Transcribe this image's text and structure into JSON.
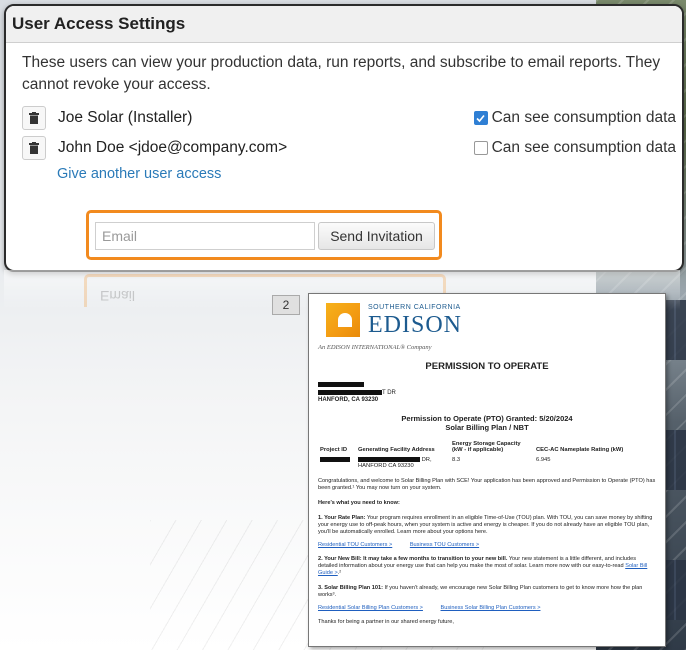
{
  "dialog": {
    "title": "User Access Settings",
    "description": "These users can view your production data, run reports, and subscribe to email reports. They cannot revoke your access.",
    "users": [
      {
        "name": "Joe Solar (Installer)",
        "consumption_label": "Can see consumption data",
        "consumption_checked": true
      },
      {
        "name": "John Doe <jdoe@company.com>",
        "consumption_label": "Can see consumption data",
        "consumption_checked": false
      }
    ],
    "give_access_link": "Give another user access",
    "email_placeholder": "Email",
    "send_button": "Send Invitation"
  },
  "reflection_text": "Email",
  "page_number": "2",
  "letter": {
    "logo_sub": "SOUTHERN CALIFORNIA",
    "logo_main": "EDISON",
    "logo_tag": "An EDISON INTERNATIONAL® Company",
    "title": "PERMISSION TO OPERATE",
    "address_line2_suffix": "T DR",
    "address_line3": "HANFORD, CA 93230",
    "pto_line1": "Permission to Operate (PTO) Granted: 5/20/2024",
    "pto_line2": "Solar Billing Plan / NBT",
    "table_headers": [
      "Project ID",
      "Generating Facility Address",
      "Energy Storage Capacity (kW - if applicable)",
      "CEC-AC Nameplate Rating (kW)"
    ],
    "table_row": {
      "address_suffix": "DR,",
      "address_city": "HANFORD CA 93230",
      "storage": "8.3",
      "rating": "6.945"
    },
    "congrats": "Congratulations, and welcome to Solar Billing Plan with SCE! Your application has been approved and Permission to Operate (PTO) has been granted.¹ You may now turn on your system.",
    "need_to_know": "Here's what you need to know:",
    "item1_head": "1. Your Rate Plan:",
    "item1_body": "Your program requires enrollment in an eligible Time-of-Use (TOU) plan. With TOU, you can save money by shifting your energy use to off-peak hours, when your system is active and energy is cheaper. If you do not already have an eligible TOU plan, you'll be automatically enrolled. Learn more about your options here.",
    "links1": [
      "Residential TOU Customers >",
      "Business TOU Customers >"
    ],
    "item2_head": "2. Your New Bill: It may take a few months to transition to your new bill.",
    "item2_body": "Your new statement is a little different, and includes detailed information about your energy use that can help you make the most of solar. Learn more now with our easy-to-read",
    "item2_link": "Solar Bill Guide >",
    "item2_tail": ".²",
    "item3_head": "3. Solar Billing Plan 101:",
    "item3_body": "If you haven't already, we encourage new Solar Billing Plan customers to get to know more how the plan works³.",
    "links3": [
      "Residential Solar Billing Plan Customers >",
      "Business Solar Billing Plan Customers >"
    ],
    "closing": "Thanks for being a partner in our shared energy future,"
  },
  "colors": {
    "link": "#2a7ab8",
    "highlight_border": "#f28a1e",
    "checkbox_checked": "#2f7fd4",
    "edison_blue": "#1d5b8f"
  }
}
